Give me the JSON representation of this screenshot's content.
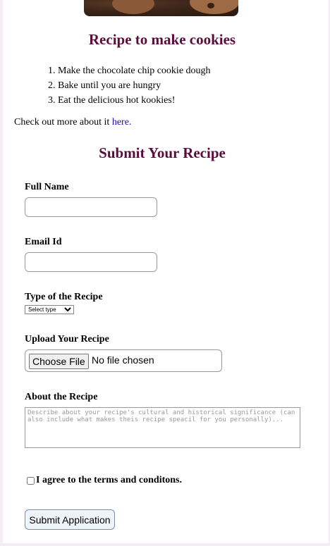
{
  "recipe": {
    "title": "Recipe to make cookies",
    "steps": [
      "Make the chocolate chip cookie dough",
      "Bake until you are hungry",
      "Eat the delicious hot kookies!"
    ],
    "more_prefix": "Check out more about it ",
    "more_link": "here."
  },
  "form": {
    "title": "Submit Your Recipe",
    "full_name_label": "Full Name",
    "email_label": "Email Id",
    "type_label": "Type of the Recipe",
    "type_selected": "Select type",
    "upload_label": "Upload Your Recipe",
    "choose_file_label": "Choose File",
    "file_status": "No file chosen",
    "about_label": "About the Recipe",
    "about_placeholder": "Describe about your recipe's cultural and historical significance (can also include what makes theis recipe speacil for you personally)...",
    "agree_label": "I agree to the terms and conditons.",
    "submit_label": "Submit Application"
  },
  "colors": {
    "heading": "#5c0c3c",
    "link": "#1a0dab"
  }
}
